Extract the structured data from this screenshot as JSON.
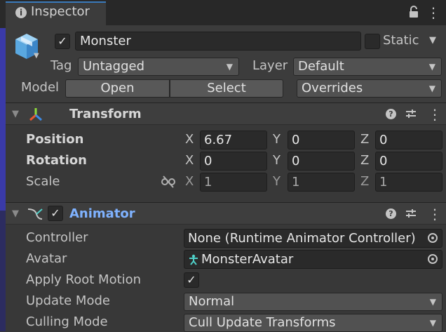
{
  "window": {
    "tab_label": "Inspector",
    "tab_icon_glyph": "i"
  },
  "header": {
    "active_checked": true,
    "name": "Monster",
    "static_label": "Static",
    "static_checked": false,
    "tag_label": "Tag",
    "tag_value": "Untagged",
    "layer_label": "Layer",
    "layer_value": "Default",
    "model_label": "Model",
    "open_label": "Open",
    "select_label": "Select",
    "overrides_value": "Overrides"
  },
  "transform": {
    "title": "Transform",
    "rows": [
      {
        "label": "Position",
        "x": "6.67",
        "y": "0",
        "z": "0"
      },
      {
        "label": "Rotation",
        "x": "0",
        "y": "0",
        "z": "0"
      },
      {
        "label": "Scale",
        "x": "1",
        "y": "1",
        "z": "1"
      }
    ],
    "axis": {
      "x": "X",
      "y": "Y",
      "z": "Z"
    }
  },
  "animator": {
    "title": "Animator",
    "enabled": true,
    "controller_label": "Controller",
    "controller_value": "None (Runtime Animator Controller)",
    "avatar_label": "Avatar",
    "avatar_value": "MonsterAvatar",
    "apply_root_motion_label": "Apply Root Motion",
    "apply_root_motion_checked": true,
    "update_mode_label": "Update Mode",
    "update_mode_value": "Normal",
    "culling_mode_label": "Culling Mode",
    "culling_mode_value": "Cull Update Transforms"
  },
  "icons": {
    "help": "?",
    "kebab": "⋮",
    "check": "✓",
    "dropdown_arrow": "▼",
    "fold_arrow": "▼"
  },
  "colors": {
    "accent_blue": "#3a79bb",
    "animator_title": "#7fb2ff",
    "panel_bg": "#383838",
    "header_bg": "#3e3e3e"
  }
}
